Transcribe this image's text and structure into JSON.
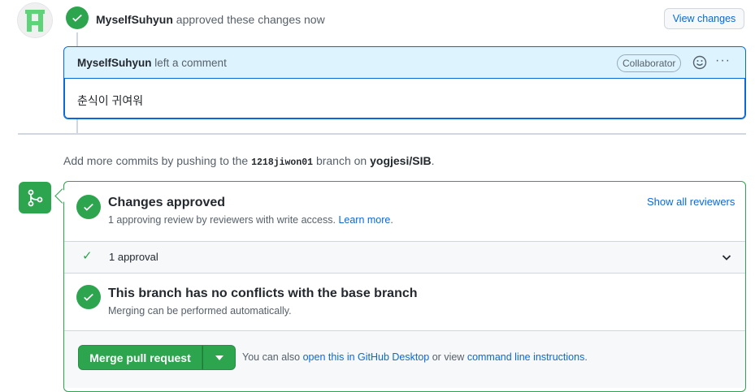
{
  "review": {
    "author": "MyselfSuhyun",
    "action": "approved these changes now",
    "view_changes": "View changes"
  },
  "comment": {
    "author": "MyselfSuhyun",
    "action": "left a comment",
    "badge": "Collaborator",
    "emoji_icon": "smiley-icon",
    "more_icon": "kebab-horizontal-icon",
    "more_label": "···",
    "body": "춘식이 귀여워"
  },
  "hint": {
    "prefix": "Add more commits by pushing to the",
    "branch": "1218jiwon01",
    "middle": "branch on",
    "repo": "yogjesi/SIB",
    "suffix": "."
  },
  "merge": {
    "approved_title": "Changes approved",
    "approved_sub": "1 approving review by reviewers with write access.",
    "learn_more": "Learn more",
    "learn_more_suffix": ".",
    "show_reviewers": "Show all reviewers",
    "approval_tick": "✓",
    "approval_label": "1 approval",
    "noconf_title": "This branch has no conflicts with the base branch",
    "noconf_sub": "Merging can be performed automatically.",
    "merge_button": "Merge pull request",
    "note_prefix": "You can also",
    "desktop_link": "open this in GitHub Desktop",
    "note_middle": "or view",
    "cli_link": "command line instructions",
    "note_suffix": "."
  },
  "colors": {
    "accent": "#0969da",
    "success": "#2da44e",
    "border": "#d0d7de",
    "comment_header_bg": "#ddf4ff"
  }
}
